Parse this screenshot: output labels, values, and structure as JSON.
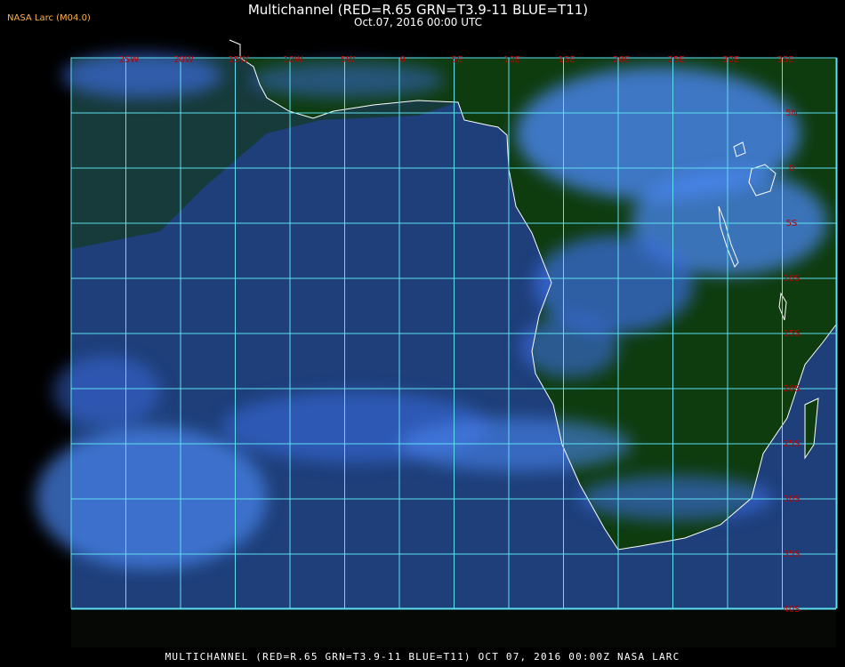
{
  "header": {
    "agency_label": "NASA Larc (M04.0)",
    "title": "Multichannel (RED=R.65 GRN=T3.9-11 BLUE=T11)",
    "datetime": "Oct.07, 2016 00:00 UTC"
  },
  "footer": {
    "caption": "MULTICHANNEL (RED=R.65 GRN=T3.9-11 BLUE=T11) OCT 07, 2016 00:00Z   NASA LARC"
  },
  "map": {
    "longitude_labels": [
      "25W",
      "20W",
      "15W",
      "10W",
      "5W",
      "0",
      "5E",
      "10E",
      "15E",
      "20E",
      "25E",
      "30E",
      "35E"
    ],
    "latitude_labels": [
      "5N",
      "0",
      "5S",
      "10S",
      "15S",
      "20S",
      "25S",
      "30S",
      "35S",
      "40S"
    ],
    "colors": {
      "land": "#0f3c0f",
      "ocean": "#1e3f7a",
      "cloud": "#3d6ee6",
      "grid": "#5fe0f0",
      "coast": "#ffffff",
      "grid_label": "#c00000"
    }
  }
}
